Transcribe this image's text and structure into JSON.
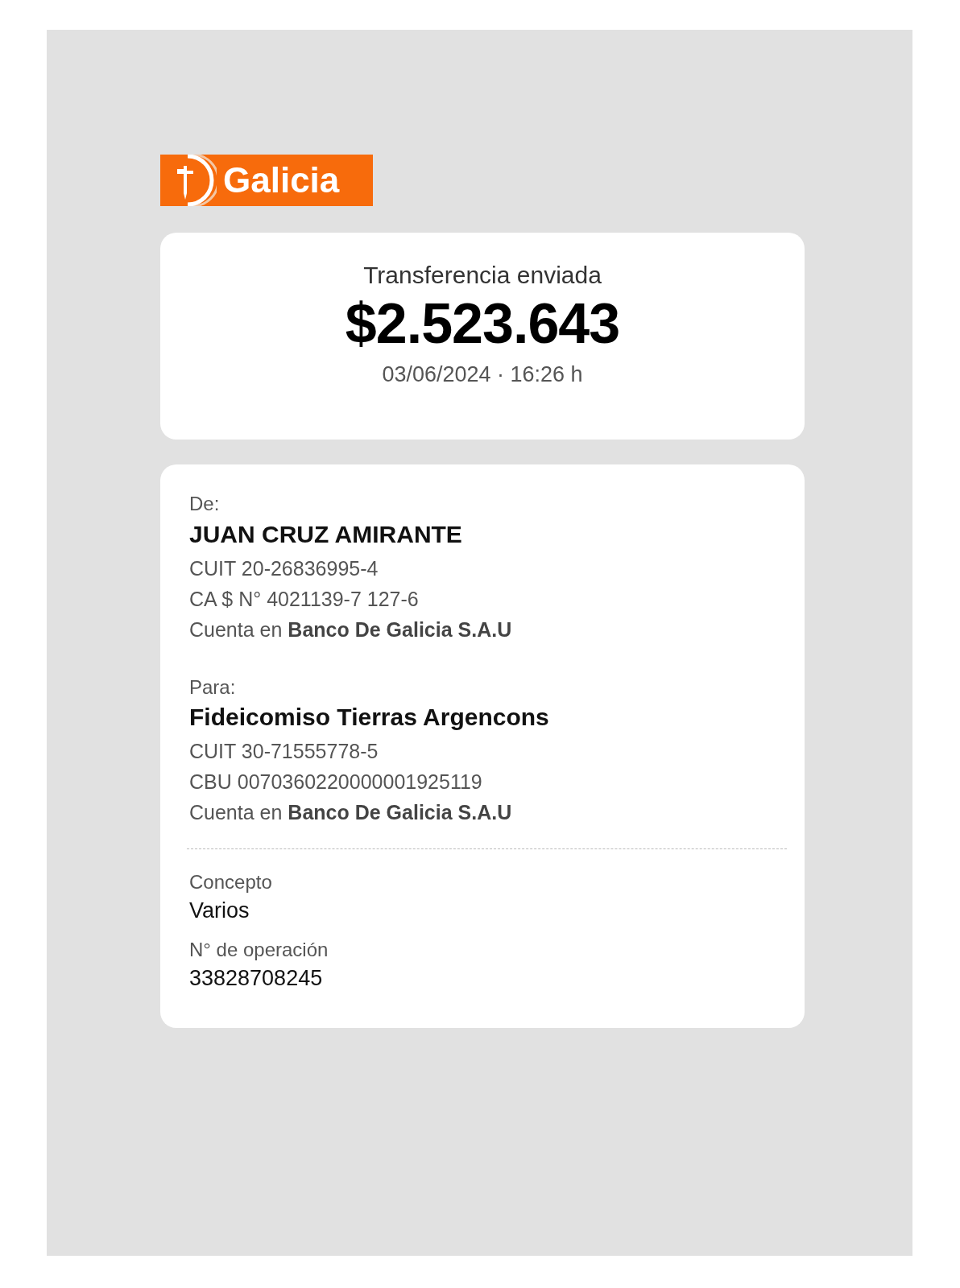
{
  "logo": {
    "text": "Galicia"
  },
  "summary": {
    "title": "Transferencia enviada",
    "amount": "$2.523.643",
    "datetime": "03/06/2024 · 16:26 h"
  },
  "parties": [
    {
      "label": "De:",
      "name": "JUAN CRUZ AMIRANTE",
      "lines": [
        "CUIT 20-26836995-4",
        "CA $ N° 4021139-7 127-6",
        "Cuenta en **Banco De Galicia S.A.U**"
      ]
    },
    {
      "label": "Para:",
      "name": "Fideicomiso Tierras Argencons",
      "lines": [
        "CUIT 30-71555778-5",
        "CBU 0070360220000001925119",
        "Cuenta en **Banco De Galicia S.A.U**"
      ]
    }
  ],
  "details": [
    {
      "label": "Concepto",
      "value": "Varios"
    },
    {
      "label": "N° de operación",
      "value": "33828708245"
    }
  ]
}
